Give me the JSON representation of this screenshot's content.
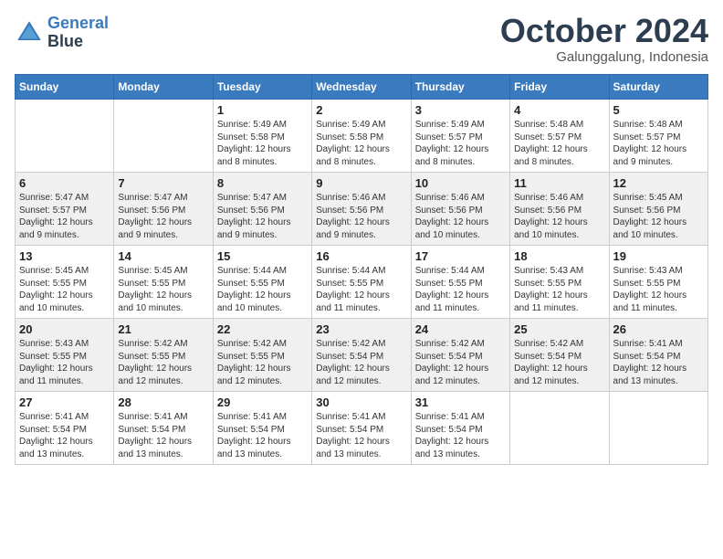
{
  "header": {
    "logo_line1": "General",
    "logo_line2": "Blue",
    "month": "October 2024",
    "location": "Galunggalung, Indonesia"
  },
  "weekdays": [
    "Sunday",
    "Monday",
    "Tuesday",
    "Wednesday",
    "Thursday",
    "Friday",
    "Saturday"
  ],
  "weeks": [
    [
      {
        "day": "",
        "info": ""
      },
      {
        "day": "",
        "info": ""
      },
      {
        "day": "1",
        "info": "Sunrise: 5:49 AM\nSunset: 5:58 PM\nDaylight: 12 hours\nand 8 minutes."
      },
      {
        "day": "2",
        "info": "Sunrise: 5:49 AM\nSunset: 5:58 PM\nDaylight: 12 hours\nand 8 minutes."
      },
      {
        "day": "3",
        "info": "Sunrise: 5:49 AM\nSunset: 5:57 PM\nDaylight: 12 hours\nand 8 minutes."
      },
      {
        "day": "4",
        "info": "Sunrise: 5:48 AM\nSunset: 5:57 PM\nDaylight: 12 hours\nand 8 minutes."
      },
      {
        "day": "5",
        "info": "Sunrise: 5:48 AM\nSunset: 5:57 PM\nDaylight: 12 hours\nand 9 minutes."
      }
    ],
    [
      {
        "day": "6",
        "info": "Sunrise: 5:47 AM\nSunset: 5:57 PM\nDaylight: 12 hours\nand 9 minutes."
      },
      {
        "day": "7",
        "info": "Sunrise: 5:47 AM\nSunset: 5:56 PM\nDaylight: 12 hours\nand 9 minutes."
      },
      {
        "day": "8",
        "info": "Sunrise: 5:47 AM\nSunset: 5:56 PM\nDaylight: 12 hours\nand 9 minutes."
      },
      {
        "day": "9",
        "info": "Sunrise: 5:46 AM\nSunset: 5:56 PM\nDaylight: 12 hours\nand 9 minutes."
      },
      {
        "day": "10",
        "info": "Sunrise: 5:46 AM\nSunset: 5:56 PM\nDaylight: 12 hours\nand 10 minutes."
      },
      {
        "day": "11",
        "info": "Sunrise: 5:46 AM\nSunset: 5:56 PM\nDaylight: 12 hours\nand 10 minutes."
      },
      {
        "day": "12",
        "info": "Sunrise: 5:45 AM\nSunset: 5:56 PM\nDaylight: 12 hours\nand 10 minutes."
      }
    ],
    [
      {
        "day": "13",
        "info": "Sunrise: 5:45 AM\nSunset: 5:55 PM\nDaylight: 12 hours\nand 10 minutes."
      },
      {
        "day": "14",
        "info": "Sunrise: 5:45 AM\nSunset: 5:55 PM\nDaylight: 12 hours\nand 10 minutes."
      },
      {
        "day": "15",
        "info": "Sunrise: 5:44 AM\nSunset: 5:55 PM\nDaylight: 12 hours\nand 10 minutes."
      },
      {
        "day": "16",
        "info": "Sunrise: 5:44 AM\nSunset: 5:55 PM\nDaylight: 12 hours\nand 11 minutes."
      },
      {
        "day": "17",
        "info": "Sunrise: 5:44 AM\nSunset: 5:55 PM\nDaylight: 12 hours\nand 11 minutes."
      },
      {
        "day": "18",
        "info": "Sunrise: 5:43 AM\nSunset: 5:55 PM\nDaylight: 12 hours\nand 11 minutes."
      },
      {
        "day": "19",
        "info": "Sunrise: 5:43 AM\nSunset: 5:55 PM\nDaylight: 12 hours\nand 11 minutes."
      }
    ],
    [
      {
        "day": "20",
        "info": "Sunrise: 5:43 AM\nSunset: 5:55 PM\nDaylight: 12 hours\nand 11 minutes."
      },
      {
        "day": "21",
        "info": "Sunrise: 5:42 AM\nSunset: 5:55 PM\nDaylight: 12 hours\nand 12 minutes."
      },
      {
        "day": "22",
        "info": "Sunrise: 5:42 AM\nSunset: 5:55 PM\nDaylight: 12 hours\nand 12 minutes."
      },
      {
        "day": "23",
        "info": "Sunrise: 5:42 AM\nSunset: 5:54 PM\nDaylight: 12 hours\nand 12 minutes."
      },
      {
        "day": "24",
        "info": "Sunrise: 5:42 AM\nSunset: 5:54 PM\nDaylight: 12 hours\nand 12 minutes."
      },
      {
        "day": "25",
        "info": "Sunrise: 5:42 AM\nSunset: 5:54 PM\nDaylight: 12 hours\nand 12 minutes."
      },
      {
        "day": "26",
        "info": "Sunrise: 5:41 AM\nSunset: 5:54 PM\nDaylight: 12 hours\nand 13 minutes."
      }
    ],
    [
      {
        "day": "27",
        "info": "Sunrise: 5:41 AM\nSunset: 5:54 PM\nDaylight: 12 hours\nand 13 minutes."
      },
      {
        "day": "28",
        "info": "Sunrise: 5:41 AM\nSunset: 5:54 PM\nDaylight: 12 hours\nand 13 minutes."
      },
      {
        "day": "29",
        "info": "Sunrise: 5:41 AM\nSunset: 5:54 PM\nDaylight: 12 hours\nand 13 minutes."
      },
      {
        "day": "30",
        "info": "Sunrise: 5:41 AM\nSunset: 5:54 PM\nDaylight: 12 hours\nand 13 minutes."
      },
      {
        "day": "31",
        "info": "Sunrise: 5:41 AM\nSunset: 5:54 PM\nDaylight: 12 hours\nand 13 minutes."
      },
      {
        "day": "",
        "info": ""
      },
      {
        "day": "",
        "info": ""
      }
    ]
  ]
}
